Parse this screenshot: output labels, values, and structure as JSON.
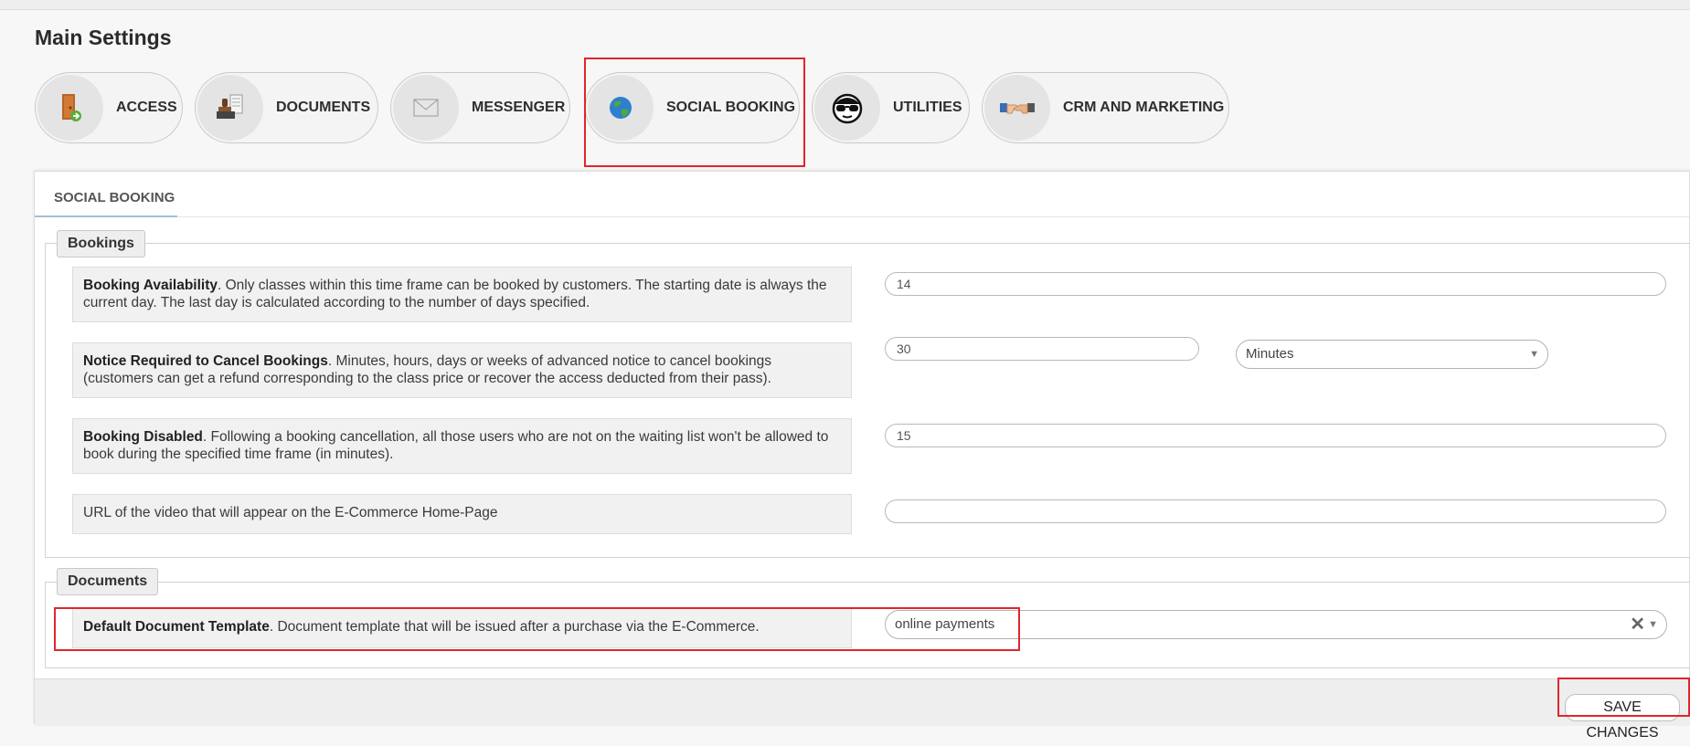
{
  "page": {
    "title": "Main Settings"
  },
  "tabs": [
    {
      "label": "ACCESS",
      "icon": "door-icon"
    },
    {
      "label": "DOCUMENTS",
      "icon": "stamp-icon"
    },
    {
      "label": "MESSENGER",
      "icon": "envelope-icon"
    },
    {
      "label": "SOCIAL BOOKING",
      "icon": "globe-icon"
    },
    {
      "label": "UTILITIES",
      "icon": "sunglasses-face-icon"
    },
    {
      "label": "CRM AND MARKETING",
      "icon": "handshake-icon"
    }
  ],
  "panel": {
    "tab_label": "SOCIAL BOOKING"
  },
  "bookings": {
    "legend": "Bookings",
    "availability": {
      "title": "Booking Availability",
      "desc": ". Only classes within this time frame can be booked by customers. The starting date is always the current day. The last day is calculated according to the number of days specified.",
      "value": "14"
    },
    "notice": {
      "title": "Notice Required to Cancel Bookings",
      "desc": ". Minutes, hours, days or weeks of advanced notice to cancel bookings (customers can get a refund corresponding to the class price or recover the access deducted from their pass).",
      "value": "30",
      "unit": "Minutes"
    },
    "disabled": {
      "title": "Booking Disabled",
      "desc": ". Following a booking cancellation, all those users who are not on the waiting list won't be allowed to book during the specified time frame (in minutes).",
      "value": "15"
    },
    "video": {
      "text": "URL of the video that will appear on the E-Commerce Home-Page",
      "value": ""
    }
  },
  "documents": {
    "legend": "Documents",
    "template": {
      "title": "Default Document Template",
      "desc": ". Document template that will be issued after a purchase via the E-Commerce.",
      "value": "online payments"
    }
  },
  "footer": {
    "save_label": "SAVE CHANGES"
  },
  "colors": {
    "highlight": "#e0262d",
    "accent_line": "#9fc0d8"
  }
}
